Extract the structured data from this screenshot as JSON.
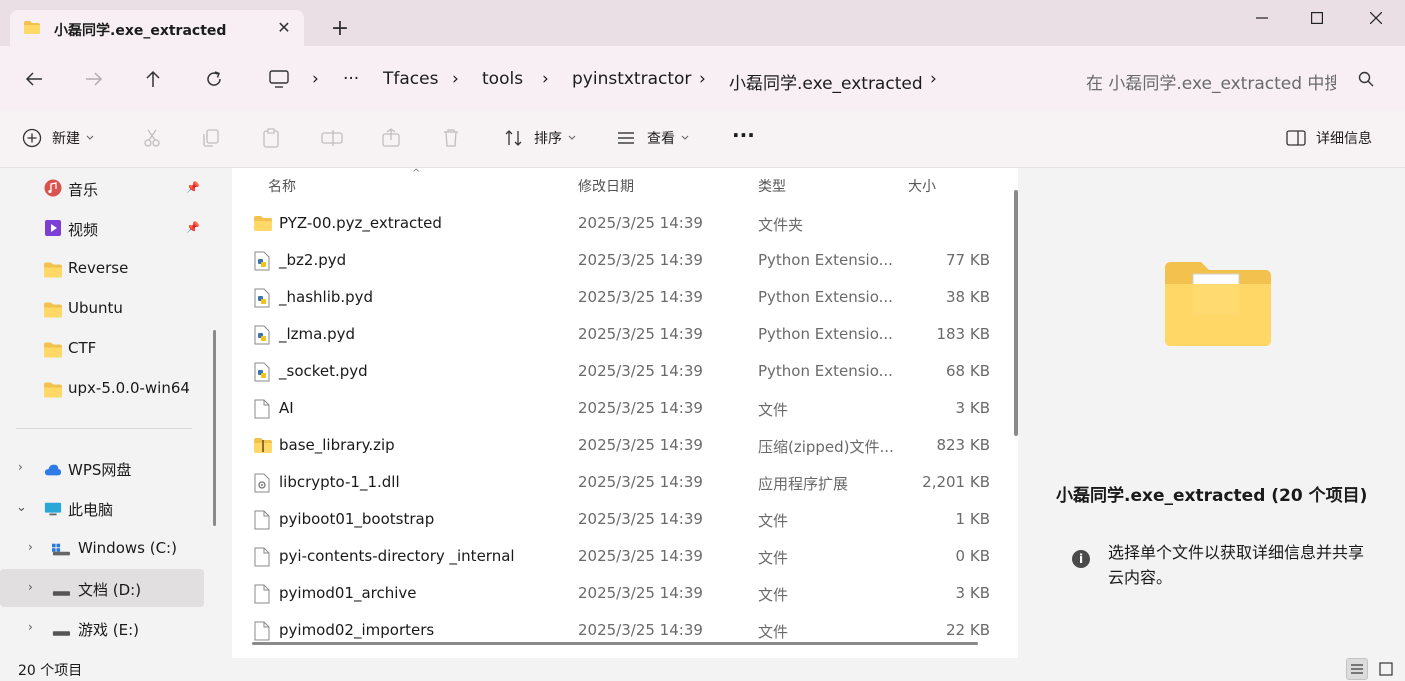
{
  "window": {
    "tab_title": "小磊同学.exe_extracted",
    "tab_close": "✕",
    "new_tab": "+",
    "minimize": "—",
    "close": "✕"
  },
  "nav": {
    "more": "···",
    "breadcrumb": [
      "Tfaces",
      "tools",
      "pyinstxtractor",
      "小磊同学.exe_extracted"
    ],
    "sep": "›",
    "search_placeholder": "在 小磊同学.exe_extracted 中搜索"
  },
  "toolbar": {
    "new_label": "新建",
    "sort_label": "排序",
    "view_label": "查看",
    "more": "···",
    "details_label": "详细信息"
  },
  "sidebar": {
    "items": [
      {
        "label": "音乐",
        "icon": "music-icon",
        "pinned": true
      },
      {
        "label": "视频",
        "icon": "video-icon",
        "pinned": true
      },
      {
        "label": "Reverse",
        "icon": "folder-icon"
      },
      {
        "label": "Ubuntu",
        "icon": "folder-icon"
      },
      {
        "label": "CTF",
        "icon": "folder-icon"
      },
      {
        "label": "upx-5.0.0-win64",
        "icon": "folder-icon"
      }
    ],
    "tree": [
      {
        "label": "WPS网盘",
        "icon": "cloud-icon",
        "expanded": false
      },
      {
        "label": "此电脑",
        "icon": "computer-icon",
        "expanded": true
      },
      {
        "label": "Windows (C:)",
        "icon": "drive-icon",
        "expanded": false
      },
      {
        "label": "文档 (D:)",
        "icon": "drive-icon",
        "expanded": false,
        "selected": true
      },
      {
        "label": "游戏 (E:)",
        "icon": "drive-icon",
        "expanded": false
      }
    ]
  },
  "columns": {
    "name": "名称",
    "date": "修改日期",
    "type": "类型",
    "size": "大小"
  },
  "files": [
    {
      "name": "PYZ-00.pyz_extracted",
      "date": "2025/3/25 14:39",
      "type": "文件夹",
      "size": "",
      "icon": "folder-icon"
    },
    {
      "name": "_bz2.pyd",
      "date": "2025/3/25 14:39",
      "type": "Python Extensio...",
      "size": "77 KB",
      "icon": "python-file-icon"
    },
    {
      "name": "_hashlib.pyd",
      "date": "2025/3/25 14:39",
      "type": "Python Extensio...",
      "size": "38 KB",
      "icon": "python-file-icon"
    },
    {
      "name": "_lzma.pyd",
      "date": "2025/3/25 14:39",
      "type": "Python Extensio...",
      "size": "183 KB",
      "icon": "python-file-icon"
    },
    {
      "name": "_socket.pyd",
      "date": "2025/3/25 14:39",
      "type": "Python Extensio...",
      "size": "68 KB",
      "icon": "python-file-icon"
    },
    {
      "name": "AI",
      "date": "2025/3/25 14:39",
      "type": "文件",
      "size": "3 KB",
      "icon": "file-icon"
    },
    {
      "name": "base_library.zip",
      "date": "2025/3/25 14:39",
      "type": "压缩(zipped)文件...",
      "size": "823 KB",
      "icon": "zip-folder-icon"
    },
    {
      "name": "libcrypto-1_1.dll",
      "date": "2025/3/25 14:39",
      "type": "应用程序扩展",
      "size": "2,201 KB",
      "icon": "dll-file-icon"
    },
    {
      "name": "pyiboot01_bootstrap",
      "date": "2025/3/25 14:39",
      "type": "文件",
      "size": "1 KB",
      "icon": "file-icon"
    },
    {
      "name": "pyi-contents-directory _internal",
      "date": "2025/3/25 14:39",
      "type": "文件",
      "size": "0 KB",
      "icon": "file-icon"
    },
    {
      "name": "pyimod01_archive",
      "date": "2025/3/25 14:39",
      "type": "文件",
      "size": "3 KB",
      "icon": "file-icon"
    },
    {
      "name": "pyimod02_importers",
      "date": "2025/3/25 14:39",
      "type": "文件",
      "size": "22 KB",
      "icon": "file-icon"
    }
  ],
  "details": {
    "title": "小磊同学.exe_extracted (20 个项目)",
    "info_icon": "i",
    "info_text": "选择单个文件以获取详细信息并共享云内容。"
  },
  "status": {
    "count": "20 个项目"
  }
}
